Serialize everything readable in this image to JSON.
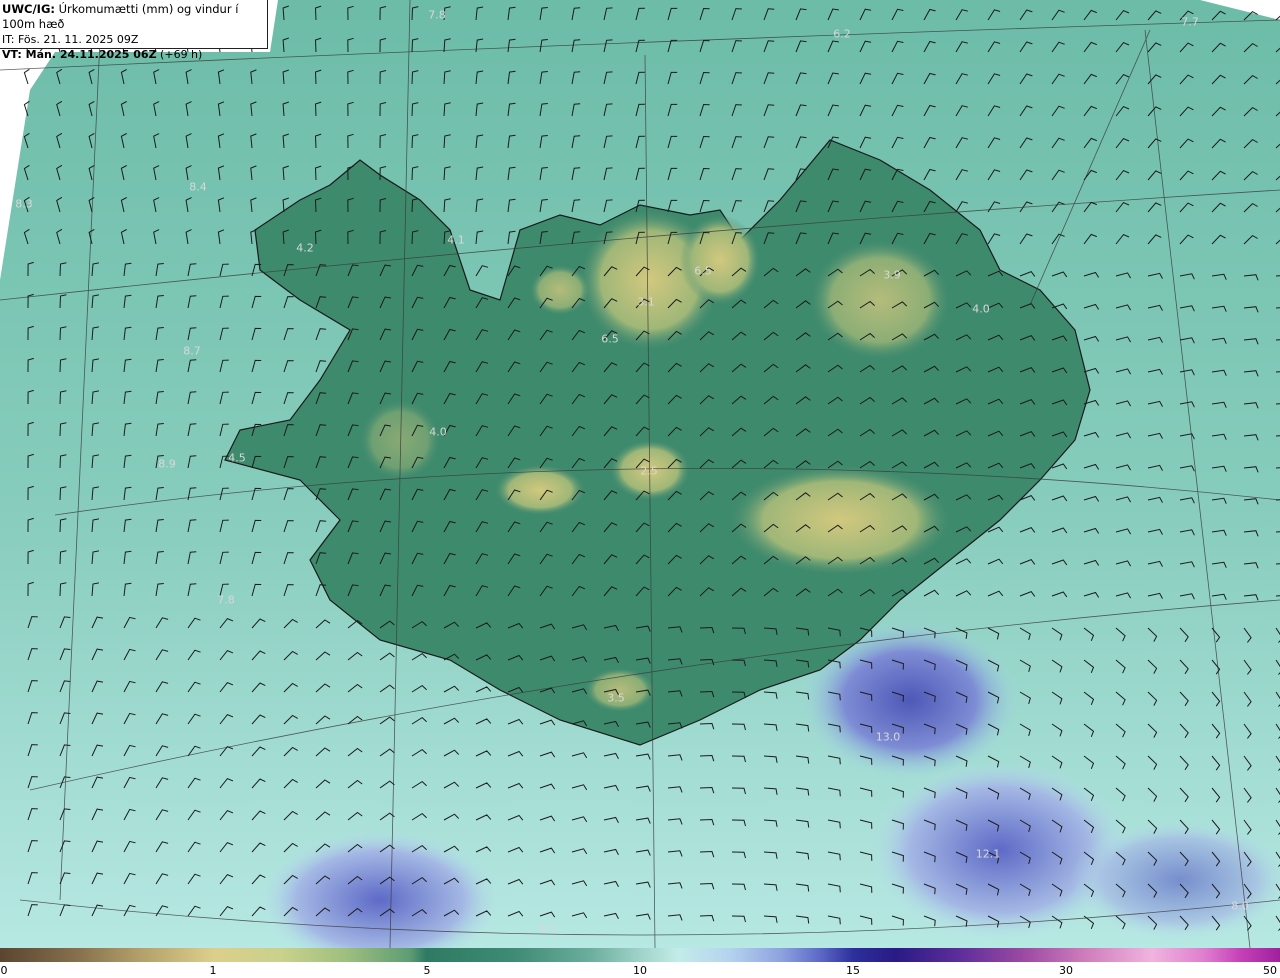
{
  "header": {
    "model": "UWC/IG:",
    "title": " Úrkomumætti (mm) og vindur í 100m hæð",
    "init_time": "IT: Fös. 21. 11. 2025 09Z",
    "valid_label": "VT: Mán. 24.11.2025 06Z",
    "lead_time": " (+69 h)"
  },
  "map_labels": [
    {
      "text": "7.8"
    },
    {
      "text": "6.2"
    },
    {
      "text": "7.7"
    },
    {
      "text": "8.4"
    },
    {
      "text": "8.3"
    },
    {
      "text": "4.1"
    },
    {
      "text": "4.2"
    },
    {
      "text": "6.5"
    },
    {
      "text": "3.9"
    },
    {
      "text": "3.1"
    },
    {
      "text": "4.0"
    },
    {
      "text": "6.5"
    },
    {
      "text": "8.7"
    },
    {
      "text": "4.0"
    },
    {
      "text": "4.5"
    },
    {
      "text": "8.9"
    },
    {
      "text": "2.5"
    },
    {
      "text": "7.8"
    },
    {
      "text": "3.5"
    },
    {
      "text": "13.0"
    },
    {
      "text": "12.1"
    },
    {
      "text": "8.5"
    },
    {
      "text": "8.0"
    }
  ],
  "colorbar": {
    "ticks": [
      "0",
      "1",
      "5",
      "10",
      "15",
      "30",
      "50"
    ]
  },
  "colors": {
    "ocean_near": "#8fd2c4",
    "ocean_far": "#bdece6",
    "land_low": "#3f8a6e",
    "land_high": "#bdbf78",
    "max_precip": "#5b67c4"
  }
}
